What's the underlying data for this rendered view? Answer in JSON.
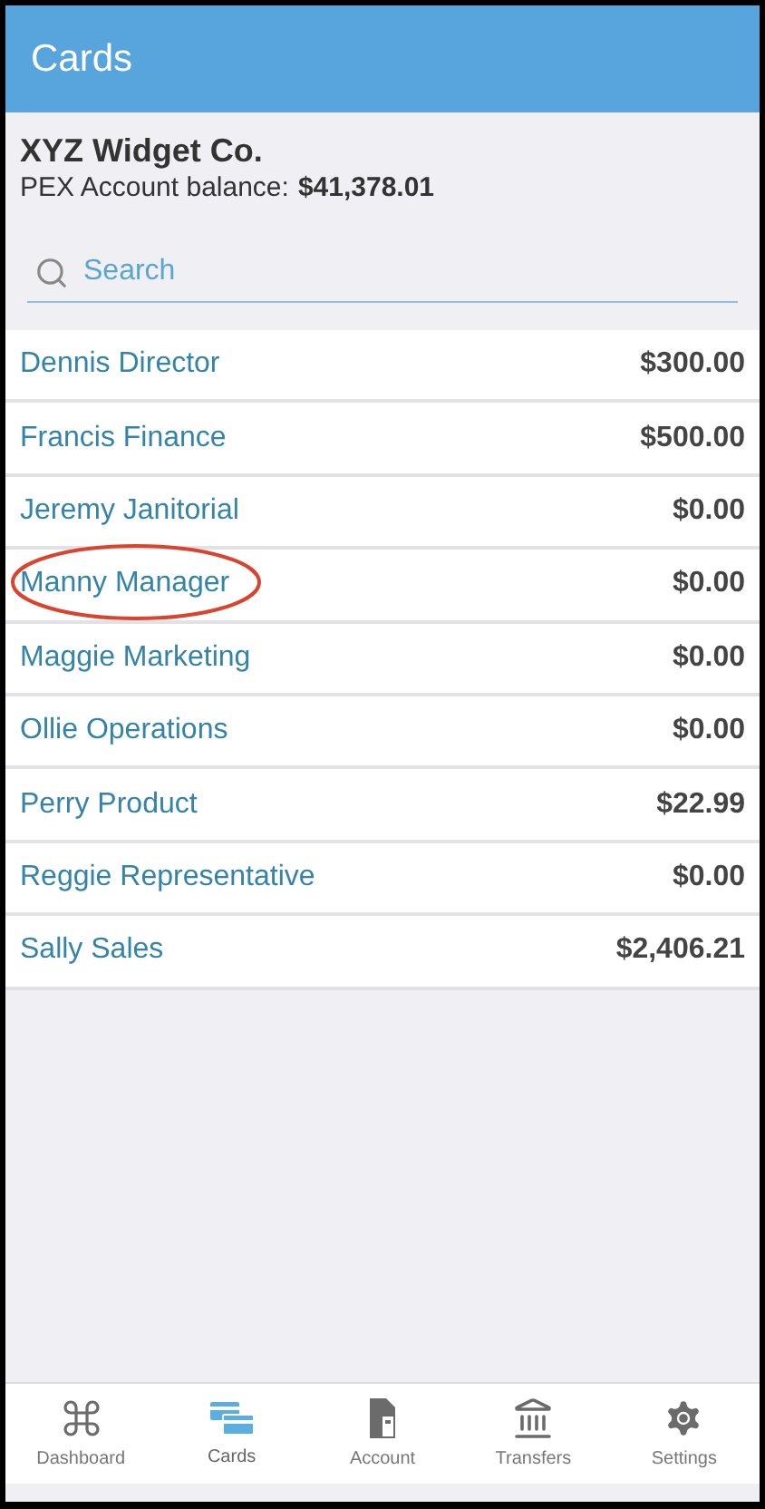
{
  "header": {
    "title": "Cards"
  },
  "account": {
    "company": "XYZ Widget Co.",
    "balance_label": "PEX Account balance:",
    "balance": "$41,378.01"
  },
  "search": {
    "placeholder": "Search"
  },
  "cards": [
    {
      "name": "Dennis Director",
      "amount": "$300.00",
      "circled": false
    },
    {
      "name": "Francis Finance",
      "amount": "$500.00",
      "circled": false
    },
    {
      "name": "Jeremy Janitorial",
      "amount": "$0.00",
      "circled": false
    },
    {
      "name": "Manny Manager",
      "amount": "$0.00",
      "circled": true
    },
    {
      "name": "Maggie Marketing",
      "amount": "$0.00",
      "circled": false
    },
    {
      "name": "Ollie Operations",
      "amount": "$0.00",
      "circled": false
    },
    {
      "name": "Perry Product",
      "amount": "$22.99",
      "circled": false
    },
    {
      "name": "Reggie Representative",
      "amount": "$0.00",
      "circled": false
    },
    {
      "name": "Sally Sales",
      "amount": "$2,406.21",
      "circled": false
    }
  ],
  "tab_bar": [
    {
      "kind": "dashboard",
      "label": "Dashboard",
      "selected": false
    },
    {
      "kind": "cards",
      "label": "Cards",
      "selected": true
    },
    {
      "kind": "account",
      "label": "Account",
      "selected": false
    },
    {
      "kind": "transfers",
      "label": "Transfers",
      "selected": false
    },
    {
      "kind": "settings",
      "label": "Settings",
      "selected": false
    }
  ]
}
